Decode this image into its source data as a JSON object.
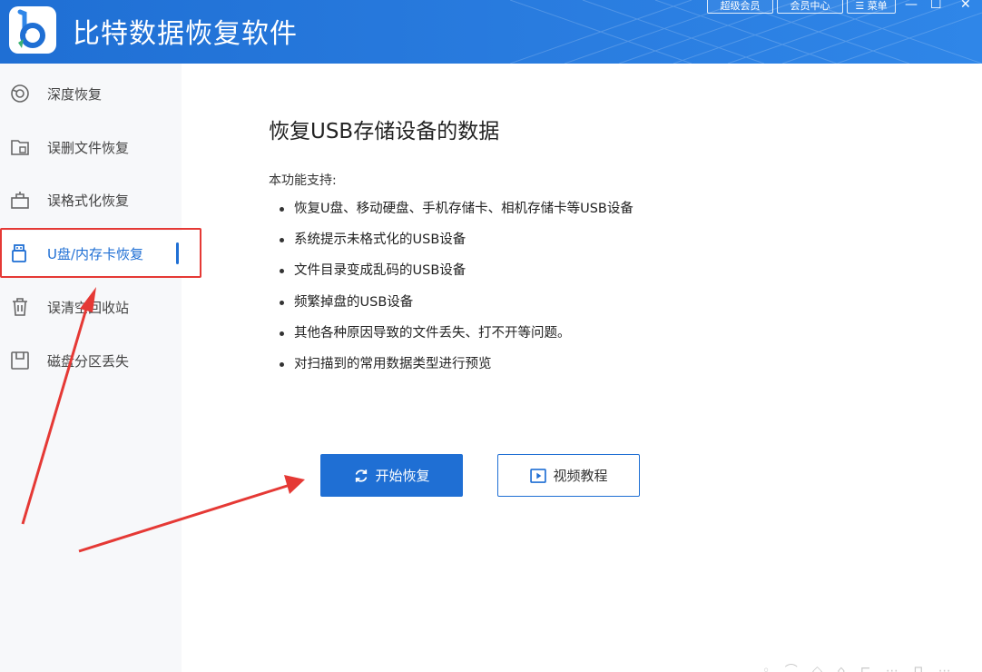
{
  "app": {
    "title": "比特数据恢复软件"
  },
  "header": {
    "buttons": {
      "super_vip": "超级会员",
      "vip_center": "会员中心",
      "menu": "菜单"
    },
    "menu_icon": "hamburger-icon",
    "window_controls": {
      "minimize": "—",
      "maximize": "☐",
      "close": "✕"
    }
  },
  "sidebar": {
    "items": [
      {
        "label": "深度恢复",
        "icon": "deep-scan-icon"
      },
      {
        "label": "误删文件恢复",
        "icon": "deleted-file-icon"
      },
      {
        "label": "误格式化恢复",
        "icon": "format-icon"
      },
      {
        "label": "U盘/内存卡恢复",
        "icon": "usb-drive-icon",
        "active": true
      },
      {
        "label": "误清空回收站",
        "icon": "recycle-bin-icon"
      },
      {
        "label": "磁盘分区丢失",
        "icon": "disk-partition-icon"
      }
    ]
  },
  "main": {
    "title": "恢复USB存储设备的数据",
    "support_label": "本功能支持:",
    "features": [
      "恢复U盘、移动硬盘、手机存储卡、相机存储卡等USB设备",
      "系统提示未格式化的USB设备",
      "文件目录变成乱码的USB设备",
      "频繁掉盘的USB设备",
      "其他各种原因导致的文件丢失、打不开等问题。",
      "对扫描到的常用数据类型进行预览"
    ],
    "start_button": "开始恢复",
    "tutorial_button": "视频教程"
  },
  "colors": {
    "brand": "#1f6fd4",
    "annotation": "#e53935",
    "sidebar_bg": "#f7f8fa"
  }
}
